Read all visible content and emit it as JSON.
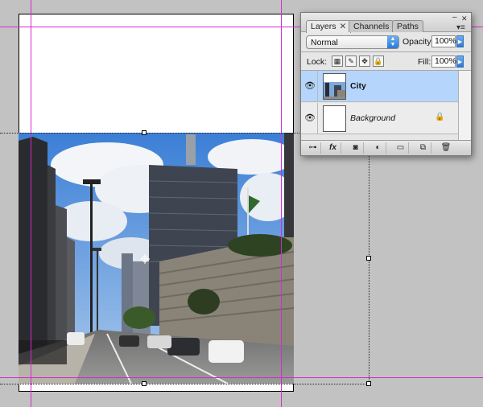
{
  "panel": {
    "tabs": [
      {
        "label": "Layers",
        "active": true
      },
      {
        "label": "Channels",
        "active": false
      },
      {
        "label": "Paths",
        "active": false
      }
    ],
    "blend_mode": "Normal",
    "opacity_label": "Opacity:",
    "opacity_value": "100%",
    "lock_label": "Lock:",
    "fill_label": "Fill:",
    "fill_value": "100%",
    "layers": [
      {
        "name": "City",
        "selected": true,
        "visible": true,
        "locked": false
      },
      {
        "name": "Background",
        "selected": false,
        "visible": true,
        "locked": true
      }
    ],
    "footer_icons": [
      "link-icon",
      "fx-icon",
      "mask-icon",
      "adjustment-icon",
      "group-icon",
      "new-layer-icon",
      "trash-icon"
    ]
  },
  "colors": {
    "guide": "#d22cd2",
    "selection_highlight": "#b6d5fc",
    "accent": "#2a79d6"
  }
}
